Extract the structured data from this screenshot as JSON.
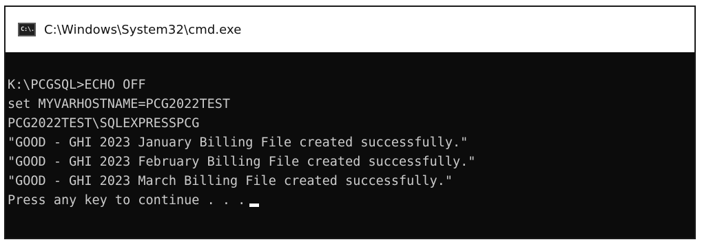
{
  "window": {
    "title": "C:\\Windows\\System32\\cmd.exe",
    "icon": "cmd-prompt-icon",
    "icon_text": "C:\\."
  },
  "console": {
    "lines": [
      "K:\\PCGSQL>ECHO OFF",
      "set MYVARHOSTNAME=PCG2022TEST",
      "PCG2022TEST\\SQLEXPRESSPCG",
      "\"GOOD - GHI 2023 January Billing File created successfully.\"",
      "\"GOOD - GHI 2023 February Billing File created successfully.\"",
      "\"GOOD - GHI 2023 March Billing File created successfully.\"",
      "Press any key to continue . . ."
    ],
    "background": "#0c0c0c",
    "foreground": "#cccccc"
  }
}
